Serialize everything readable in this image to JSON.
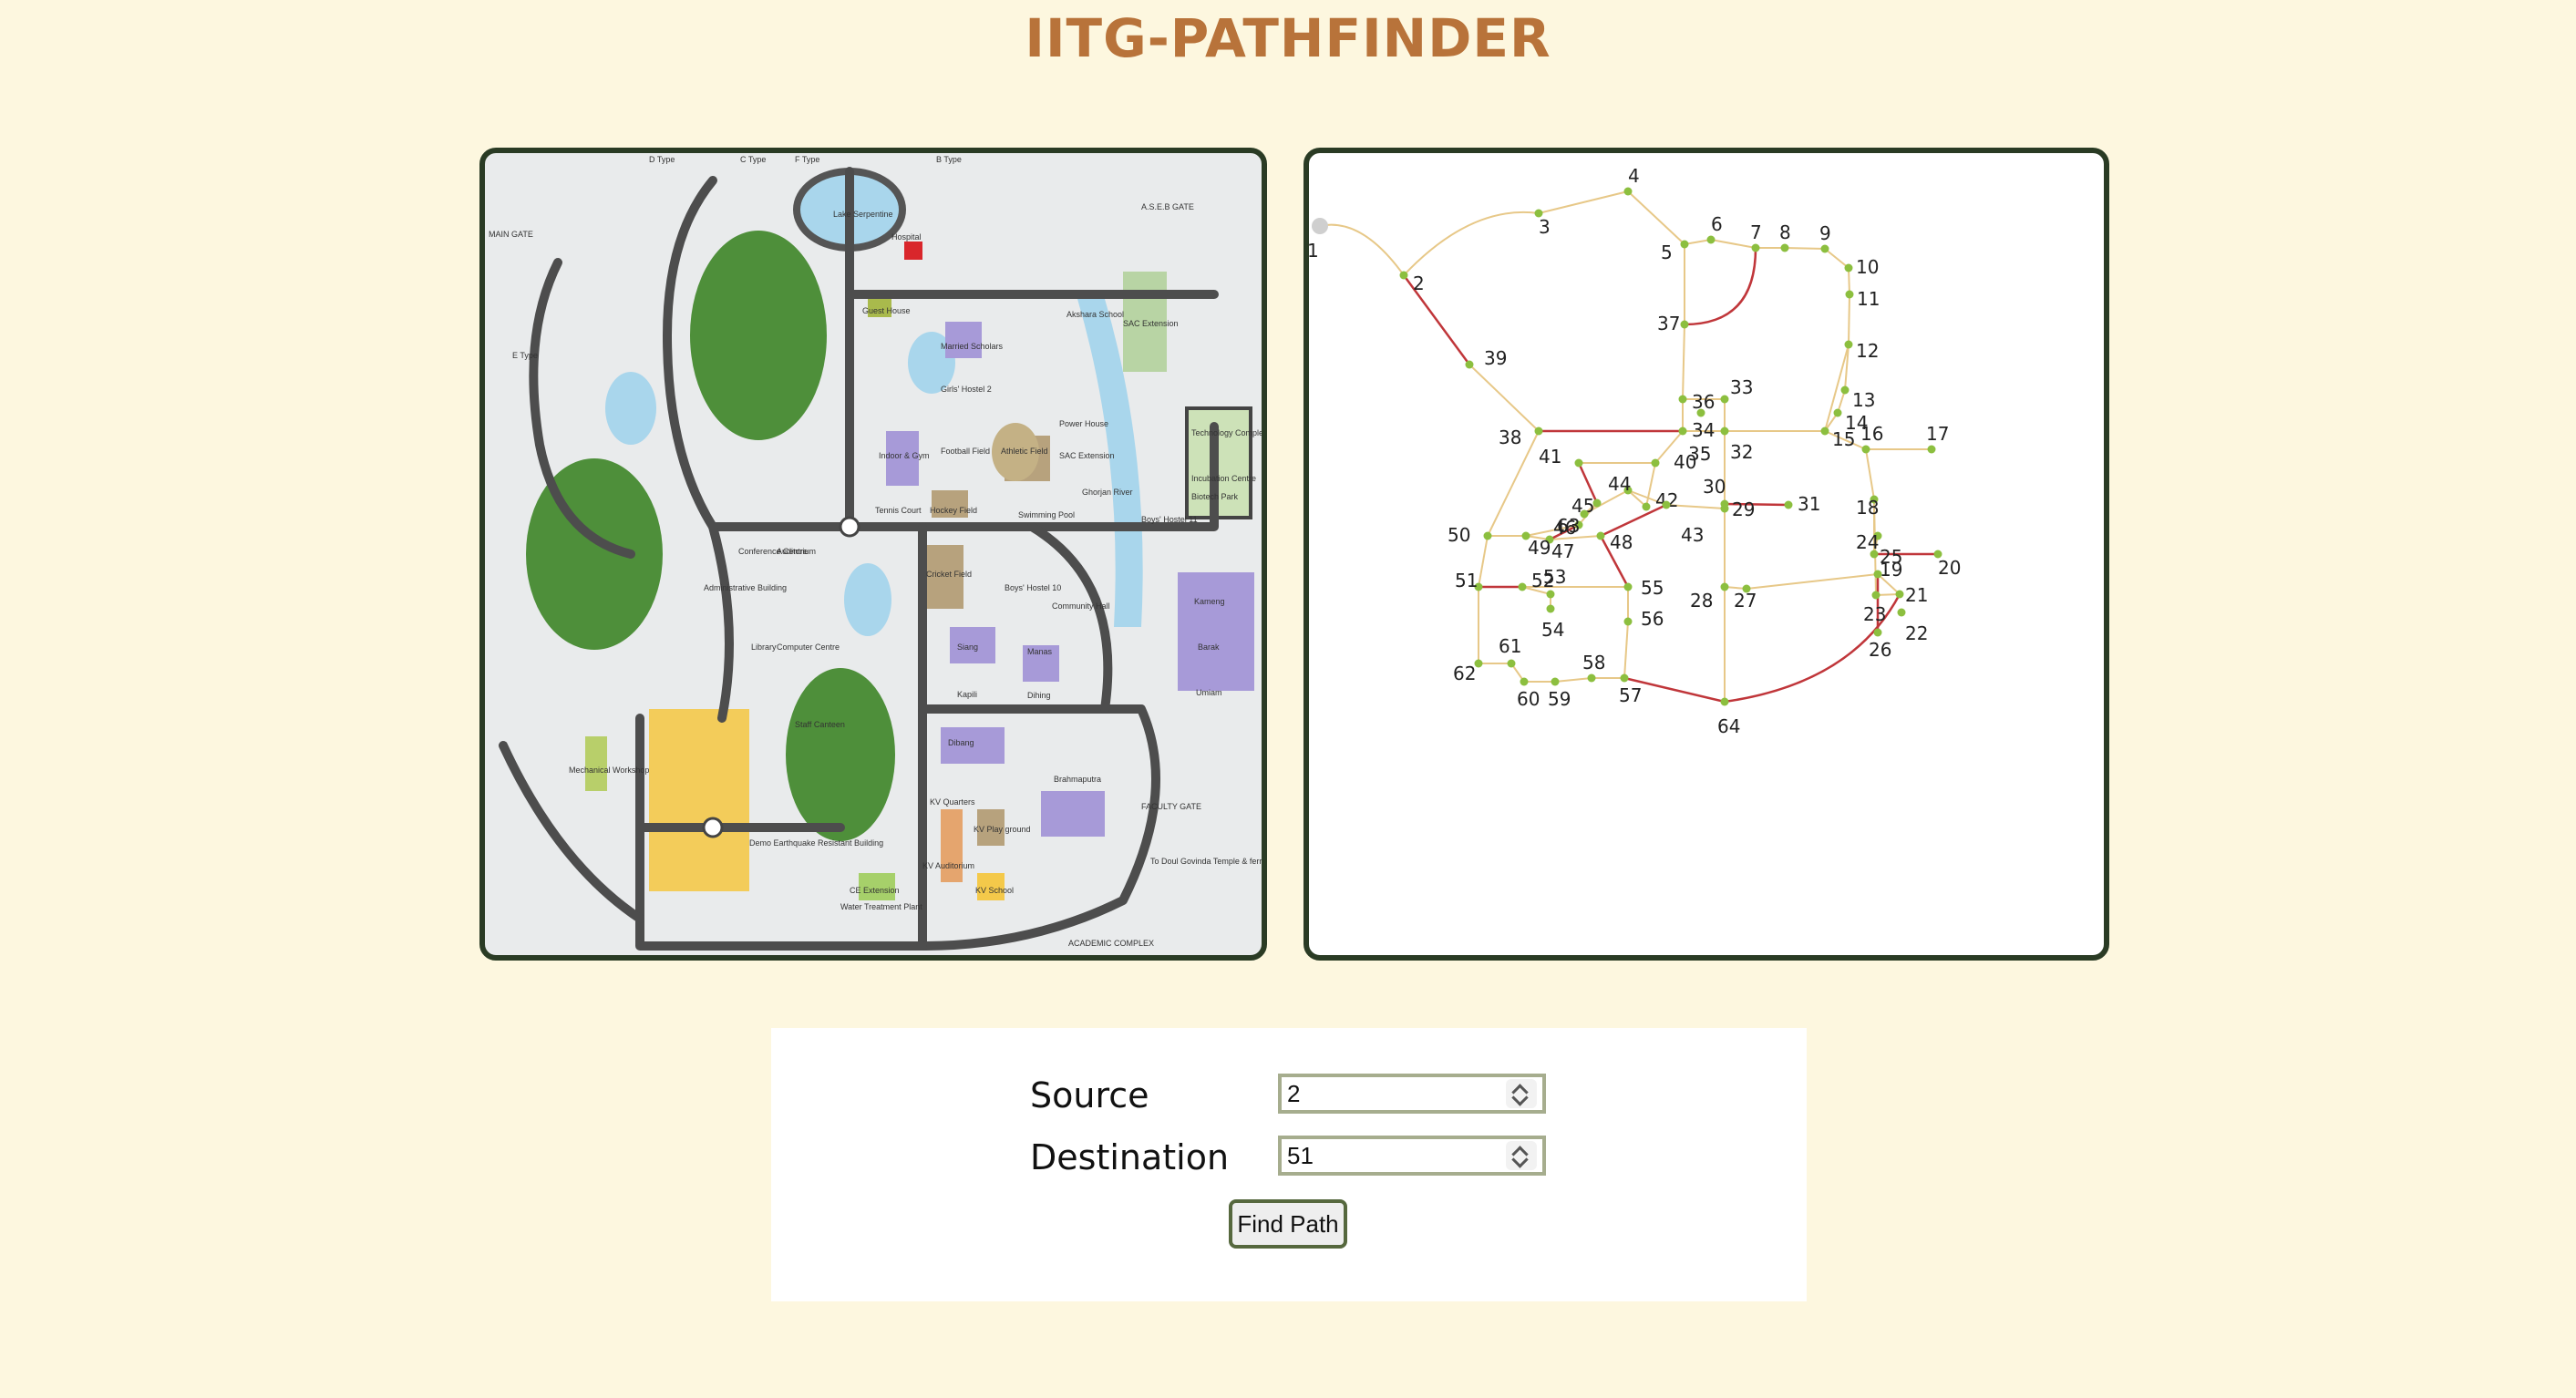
{
  "app": {
    "title": "IITG-PATHFINDER"
  },
  "map": {
    "labels": {
      "lake": "Lake Serpentine",
      "hospital": "Hospital",
      "guest_house": "Guest House",
      "married_scholars": "Married Scholars",
      "girls_hostel_2": "Girls' Hostel 2",
      "akshara": "Akshara School",
      "sac_extension": "SAC Extension",
      "technology_complex": "Technology Complex",
      "incubation": "Incubation Centre",
      "biotech": "Biotech Park",
      "indoor_gym": "Indoor & Gym",
      "football": "Football Field",
      "athletic": "Athletic Field",
      "power_house": "Power House",
      "sac_extension_2": "SAC Extension",
      "tennis": "Tennis Court",
      "hockey": "Hockey Field",
      "swimming": "Swimming Pool",
      "ghorjan": "Ghorjan River",
      "boys_hostel_11": "Boys' Hostel 11",
      "cricket": "Cricket Field",
      "boys_hostel_10": "Boys' Hostel 10",
      "community_hall": "Community Hall",
      "kameng": "Kameng",
      "barak": "Barak",
      "umiam": "Umiam",
      "siang": "Siang",
      "kapili": "Kapili",
      "manas": "Manas",
      "dihing": "Dihing",
      "dibang": "Dibang",
      "brahmaputra": "Brahmaputra",
      "kv_quarters": "KV Quarters",
      "kv_playground": "KV Play ground",
      "kv_auditorium": "KV Auditorium",
      "kv_school": "KV School",
      "staff_canteen": "Staff Canteen",
      "demo_building": "Demo Earthquake Resistant Building",
      "ce_extension": "CE Extension",
      "water_plant": "Water Treatment Plant",
      "academic_complex": "ACADEMIC COMPLEX",
      "asb_gate": "A.S.E.B GATE",
      "faculty_gate": "FACULTY GATE",
      "doul_govinda": "To Doul Govinda Temple & ferry Ghat",
      "d_type": "D Type",
      "c_type": "C Type",
      "f_type": "F Type",
      "b_type": "B Type",
      "e_type": "E Type",
      "main_gate": "MAIN GATE",
      "administrative": "Administrative Building",
      "library": "Library",
      "computer_centre": "Computer Centre",
      "mechanical_workshop": "Mechanical Workshop",
      "conference_centre": "Conference Centre",
      "auditorium": "Auditorium"
    }
  },
  "graph": {
    "nodes": [
      "1",
      "2",
      "3",
      "4",
      "5",
      "6",
      "7",
      "8",
      "9",
      "10",
      "11",
      "12",
      "13",
      "14",
      "15",
      "16",
      "17",
      "18",
      "19",
      "20",
      "21",
      "22",
      "23",
      "24",
      "25",
      "26",
      "27",
      "28",
      "29",
      "30",
      "31",
      "32",
      "33",
      "34",
      "35",
      "36",
      "37",
      "38",
      "39",
      "40",
      "41",
      "42",
      "43",
      "44",
      "45",
      "46",
      "47",
      "48",
      "49",
      "50",
      "51",
      "52",
      "53",
      "54",
      "55",
      "56",
      "57",
      "58",
      "59",
      "60",
      "61",
      "62",
      "63",
      "64"
    ]
  },
  "form": {
    "source_label": "Source",
    "source_value": "2",
    "destination_label": "Destination",
    "destination_value": "51",
    "find_button": "Find Path"
  },
  "colors": {
    "background": "#fdf7df",
    "title": "#b8733a",
    "panel_border": "#2a3b24",
    "edge_light": "#e7c888",
    "edge_path": "#c0363a",
    "node": "#8cbf3f"
  }
}
